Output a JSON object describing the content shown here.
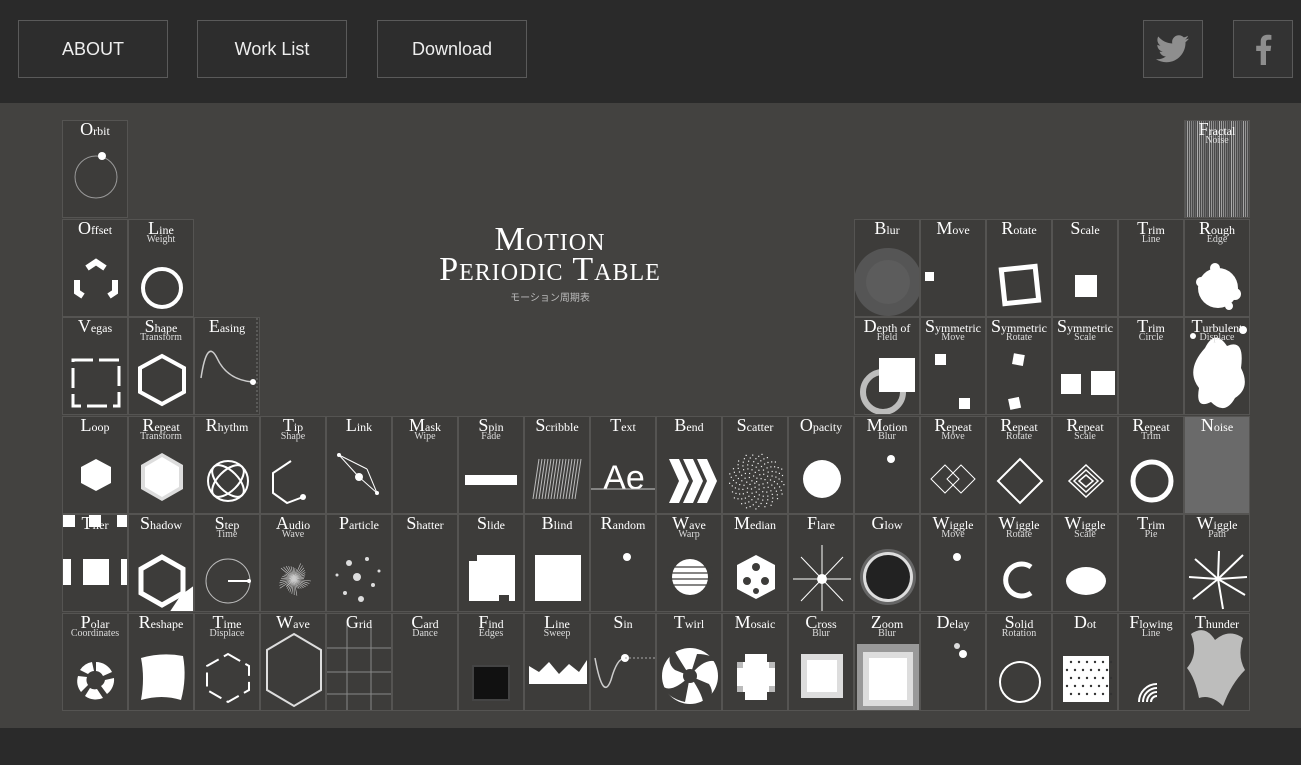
{
  "nav": {
    "about": "ABOUT",
    "work_list": "Work List",
    "download": "Download"
  },
  "social": {
    "twitter": "twitter-icon",
    "facebook": "facebook-icon"
  },
  "title": {
    "line1": "Motion",
    "line2": "Periodic Table",
    "sub": "モーション周期表"
  },
  "colors": {
    "bg": "#434240",
    "cell": "#3d3c3a",
    "border": "#555452",
    "topbar": "#2a2a2a"
  },
  "cells": [
    {
      "c": 0,
      "r": 0,
      "n": "Orbit",
      "s": "",
      "i": "orbit"
    },
    {
      "c": 17,
      "r": 0,
      "n": "Fractal",
      "s": "Noise",
      "i": "noise-lines"
    },
    {
      "c": 0,
      "r": 1,
      "n": "Offset",
      "s": "",
      "i": "offset"
    },
    {
      "c": 1,
      "r": 1,
      "n": "Line",
      "s": "Weight",
      "i": "ring"
    },
    {
      "c": 12,
      "r": 1,
      "n": "Blur",
      "s": "",
      "i": "blur"
    },
    {
      "c": 13,
      "r": 1,
      "n": "Move",
      "s": "",
      "i": "move"
    },
    {
      "c": 14,
      "r": 1,
      "n": "Rotate",
      "s": "",
      "i": "rotate"
    },
    {
      "c": 15,
      "r": 1,
      "n": "Scale",
      "s": "",
      "i": "scale"
    },
    {
      "c": 16,
      "r": 1,
      "n": "Trim",
      "s": "Line",
      "i": "none"
    },
    {
      "c": 17,
      "r": 1,
      "n": "Rough",
      "s": "Edge",
      "i": "rough"
    },
    {
      "c": 0,
      "r": 2,
      "n": "Vegas",
      "s": "",
      "i": "vegas"
    },
    {
      "c": 1,
      "r": 2,
      "n": "Shape",
      "s": "Transform",
      "i": "hex-outline"
    },
    {
      "c": 2,
      "r": 2,
      "n": "Easing",
      "s": "",
      "i": "easing"
    },
    {
      "c": 12,
      "r": 2,
      "n": "Depth of",
      "s": "Field",
      "i": "dof"
    },
    {
      "c": 13,
      "r": 2,
      "n": "Symmetric",
      "s": "Move",
      "i": "sym-move"
    },
    {
      "c": 14,
      "r": 2,
      "n": "Symmetric",
      "s": "Rotate",
      "i": "sym-rotate"
    },
    {
      "c": 15,
      "r": 2,
      "n": "Symmetric",
      "s": "Scale",
      "i": "sym-scale"
    },
    {
      "c": 16,
      "r": 2,
      "n": "Trim",
      "s": "Circle",
      "i": "none"
    },
    {
      "c": 17,
      "r": 2,
      "n": "Turbulent",
      "s": "Displace",
      "i": "turbulent"
    },
    {
      "c": 0,
      "r": 3,
      "n": "Loop",
      "s": "",
      "i": "hex-fill"
    },
    {
      "c": 1,
      "r": 3,
      "n": "Repeat",
      "s": "Transform",
      "i": "repeat-transform"
    },
    {
      "c": 2,
      "r": 3,
      "n": "Rhythm",
      "s": "",
      "i": "rhythm"
    },
    {
      "c": 3,
      "r": 3,
      "n": "Tip",
      "s": "Shape",
      "i": "tip"
    },
    {
      "c": 4,
      "r": 3,
      "n": "Link",
      "s": "",
      "i": "link"
    },
    {
      "c": 5,
      "r": 3,
      "n": "Mask",
      "s": "Wipe",
      "i": "none"
    },
    {
      "c": 6,
      "r": 3,
      "n": "Spin",
      "s": "Fade",
      "i": "bar"
    },
    {
      "c": 7,
      "r": 3,
      "n": "Scribble",
      "s": "",
      "i": "scribble"
    },
    {
      "c": 8,
      "r": 3,
      "n": "Text",
      "s": "",
      "i": "text-ae"
    },
    {
      "c": 9,
      "r": 3,
      "n": "Bend",
      "s": "",
      "i": "chevrons"
    },
    {
      "c": 10,
      "r": 3,
      "n": "Scatter",
      "s": "",
      "i": "scatter"
    },
    {
      "c": 11,
      "r": 3,
      "n": "Opacity",
      "s": "",
      "i": "circle"
    },
    {
      "c": 12,
      "r": 3,
      "n": "Motion",
      "s": "Blur",
      "i": "dot-small"
    },
    {
      "c": 13,
      "r": 3,
      "n": "Repeat",
      "s": "Move",
      "i": "diamonds"
    },
    {
      "c": 14,
      "r": 3,
      "n": "Repeat",
      "s": "Rotate",
      "i": "diamond"
    },
    {
      "c": 15,
      "r": 3,
      "n": "Repeat",
      "s": "Scale",
      "i": "nested-diamond"
    },
    {
      "c": 16,
      "r": 3,
      "n": "Repeat",
      "s": "Trim",
      "i": "ring-thick"
    },
    {
      "c": 17,
      "r": 3,
      "n": "Noise",
      "s": "",
      "i": "noise-gray"
    },
    {
      "c": 0,
      "r": 4,
      "n": "Tiler",
      "s": "",
      "i": "tiler"
    },
    {
      "c": 1,
      "r": 4,
      "n": "Shadow",
      "s": "",
      "i": "shadow"
    },
    {
      "c": 2,
      "r": 4,
      "n": "Step",
      "s": "Time",
      "i": "clock"
    },
    {
      "c": 3,
      "r": 4,
      "n": "Audio",
      "s": "Wave",
      "i": "audio"
    },
    {
      "c": 4,
      "r": 4,
      "n": "Particle",
      "s": "",
      "i": "particle"
    },
    {
      "c": 5,
      "r": 4,
      "n": "Shatter",
      "s": "",
      "i": "none"
    },
    {
      "c": 6,
      "r": 4,
      "n": "Slide",
      "s": "",
      "i": "slide"
    },
    {
      "c": 7,
      "r": 4,
      "n": "Blind",
      "s": "",
      "i": "square"
    },
    {
      "c": 8,
      "r": 4,
      "n": "Random",
      "s": "",
      "i": "dot-small"
    },
    {
      "c": 9,
      "r": 4,
      "n": "Wave",
      "s": "Warp",
      "i": "wave-warp"
    },
    {
      "c": 10,
      "r": 4,
      "n": "Median",
      "s": "",
      "i": "median"
    },
    {
      "c": 11,
      "r": 4,
      "n": "Flare",
      "s": "",
      "i": "flare"
    },
    {
      "c": 12,
      "r": 4,
      "n": "Glow",
      "s": "",
      "i": "glow"
    },
    {
      "c": 13,
      "r": 4,
      "n": "Wiggle",
      "s": "Move",
      "i": "dot-small"
    },
    {
      "c": 14,
      "r": 4,
      "n": "Wiggle",
      "s": "Rotate",
      "i": "c-shape"
    },
    {
      "c": 15,
      "r": 4,
      "n": "Wiggle",
      "s": "Scale",
      "i": "ellipse"
    },
    {
      "c": 16,
      "r": 4,
      "n": "Trim",
      "s": "Pie",
      "i": "none"
    },
    {
      "c": 17,
      "r": 4,
      "n": "Wiggle",
      "s": "Path",
      "i": "starburst"
    },
    {
      "c": 0,
      "r": 5,
      "n": "Polar",
      "s": "Coordinates",
      "i": "polar"
    },
    {
      "c": 1,
      "r": 5,
      "n": "Reshape",
      "s": "",
      "i": "reshape"
    },
    {
      "c": 2,
      "r": 5,
      "n": "Time",
      "s": "Displace",
      "i": "hex-dash"
    },
    {
      "c": 3,
      "r": 5,
      "n": "Wave",
      "s": "",
      "i": "hex-big"
    },
    {
      "c": 4,
      "r": 5,
      "n": "Grid",
      "s": "",
      "i": "grid"
    },
    {
      "c": 5,
      "r": 5,
      "n": "Card",
      "s": "Dance",
      "i": "none"
    },
    {
      "c": 6,
      "r": 5,
      "n": "Find",
      "s": "Edges",
      "i": "find-edges"
    },
    {
      "c": 7,
      "r": 5,
      "n": "Line",
      "s": "Sweep",
      "i": "sweep"
    },
    {
      "c": 8,
      "r": 5,
      "n": "Sin",
      "s": "",
      "i": "sin"
    },
    {
      "c": 9,
      "r": 5,
      "n": "Twirl",
      "s": "",
      "i": "twirl"
    },
    {
      "c": 10,
      "r": 5,
      "n": "Mosaic",
      "s": "",
      "i": "mosaic"
    },
    {
      "c": 11,
      "r": 5,
      "n": "Cross",
      "s": "Blur",
      "i": "cross-blur"
    },
    {
      "c": 12,
      "r": 5,
      "n": "Zoom",
      "s": "Blur",
      "i": "zoom-blur"
    },
    {
      "c": 13,
      "r": 5,
      "n": "Delay",
      "s": "",
      "i": "delay"
    },
    {
      "c": 14,
      "r": 5,
      "n": "Solid",
      "s": "Rotation",
      "i": "ring-thin"
    },
    {
      "c": 15,
      "r": 5,
      "n": "Dot",
      "s": "",
      "i": "dots"
    },
    {
      "c": 16,
      "r": 5,
      "n": "Flowing",
      "s": "Line",
      "i": "arcs"
    },
    {
      "c": 17,
      "r": 5,
      "n": "Thunder",
      "s": "",
      "i": "thunder"
    }
  ]
}
